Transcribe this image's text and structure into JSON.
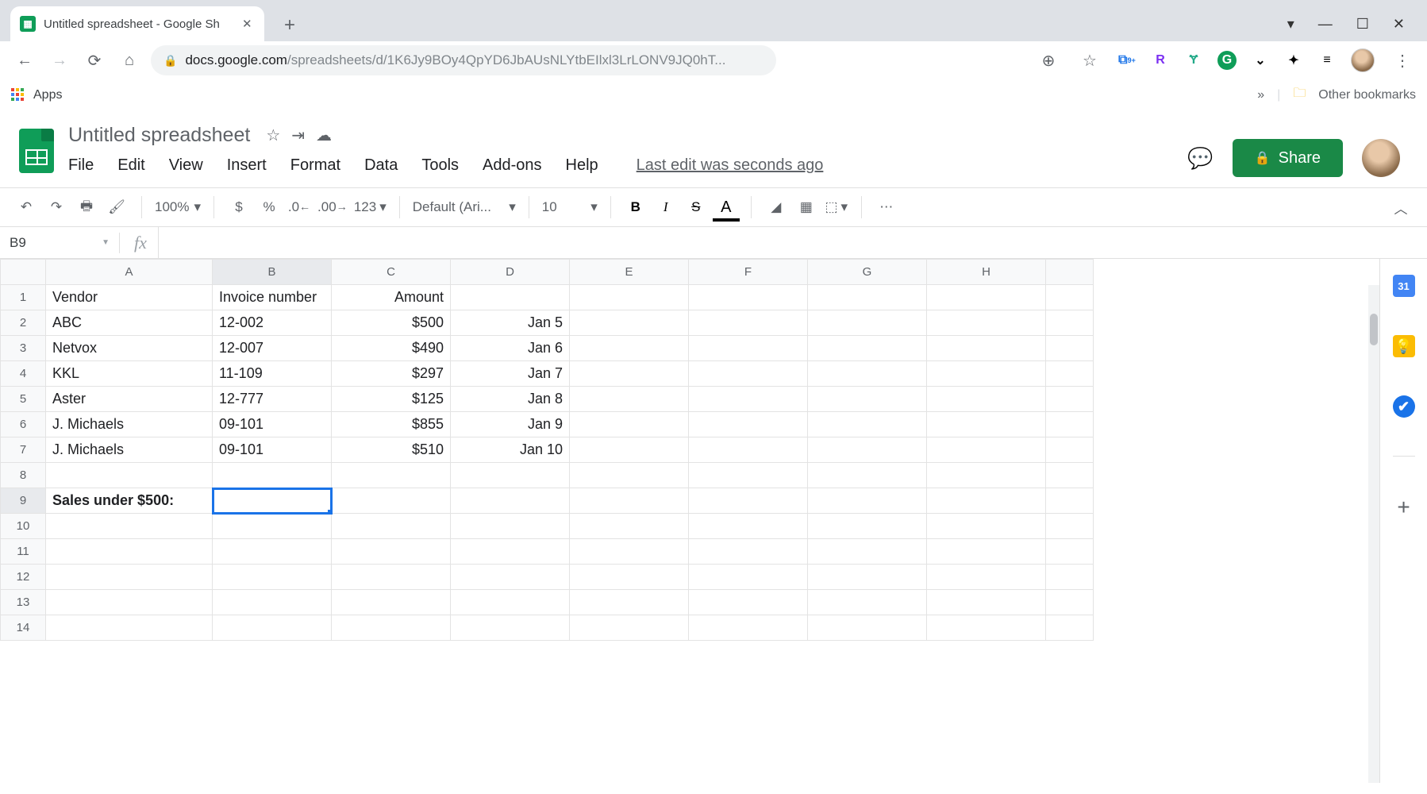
{
  "browser": {
    "tab_title": "Untitled spreadsheet - Google Sh",
    "url_host": "docs.google.com",
    "url_path": "/spreadsheets/d/1K6Jy9BOy4QpYD6JbAUsNLYtbEIlxl3LrLONV9JQ0hT...",
    "apps_label": "Apps",
    "other_bookmarks": "Other bookmarks"
  },
  "doc": {
    "title": "Untitled spreadsheet",
    "share_label": "Share",
    "last_edit": "Last edit was seconds ago"
  },
  "menu": {
    "file": "File",
    "edit": "Edit",
    "view": "View",
    "insert": "Insert",
    "format": "Format",
    "data": "Data",
    "tools": "Tools",
    "addons": "Add-ons",
    "help": "Help"
  },
  "toolbar": {
    "zoom": "100%",
    "currency": "$",
    "percent": "%",
    "dec_inc": ".0",
    "dec_dec": ".00",
    "num_fmt": "123",
    "font": "Default (Ari...",
    "font_size": "10"
  },
  "namebox": "B9",
  "formula": "",
  "columns": [
    "A",
    "B",
    "C",
    "D",
    "E",
    "F",
    "G",
    "H"
  ],
  "rows": [
    "1",
    "2",
    "3",
    "4",
    "5",
    "6",
    "7",
    "8",
    "9",
    "10",
    "11",
    "12",
    "13",
    "14"
  ],
  "selected": {
    "row": 9,
    "col": "B"
  },
  "cells": {
    "A1": "Vendor",
    "B1": "Invoice number",
    "C1": "Amount",
    "A2": "ABC",
    "B2": "12-002",
    "C2": "$500",
    "D2": "Jan 5",
    "A3": "Netvox",
    "B3": "12-007",
    "C3": "$490",
    "D3": "Jan 6",
    "A4": "KKL",
    "B4": "11-109",
    "C4": "$297",
    "D4": "Jan 7",
    "A5": "Aster",
    "B5": "12-777",
    "C5": "$125",
    "D5": "Jan 8",
    "A6": "J. Michaels",
    "B6": "09-101",
    "C6": "$855",
    "D6": "Jan 9",
    "A7": "J. Michaels",
    "B7": "09-101",
    "C7": "$510",
    "D7": "Jan 10",
    "A9": "Sales under $500:"
  },
  "side": {
    "calendar": "31"
  }
}
